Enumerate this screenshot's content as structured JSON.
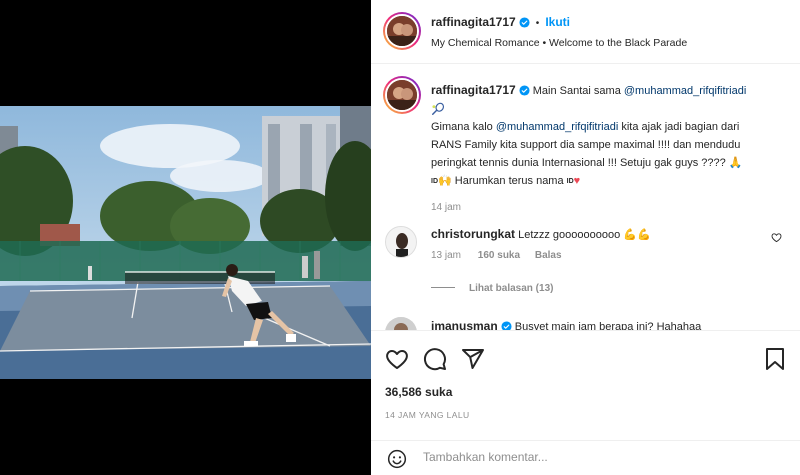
{
  "header": {
    "username": "raffinagita1717",
    "separator": "•",
    "follow_label": "Ikuti",
    "subtitle": "My Chemical Romance • Welcome to the Black Parade"
  },
  "caption": {
    "username": "raffinagita1717",
    "title_text": "Main Santai sama",
    "title_mention": "@muhammad_rifqifitriadi",
    "line1_pre": "Gimana kalo",
    "line1_mention": "@muhammad_rifqifitriadi",
    "line1_post": "kita ajak jadi bagian dari",
    "line2": "RANS Family kita support dia sampe maximal !!!! dan mendudu",
    "line3": "peringkat tennis dunia Internasional !!! Setuju gak guys ????",
    "line4": "Harumkan terus nama",
    "time": "14 jam"
  },
  "comments": [
    {
      "username": "christorungkat",
      "text": "Letzzz goooooooooo",
      "time": "13 jam",
      "likes": "160 suka",
      "reply": "Balas",
      "view_replies": "Lihat balasan (13)"
    },
    {
      "username": "imanusman",
      "text": "Busyet main jam berapa ini? Hahahaa"
    }
  ],
  "actions": {
    "likes": "36,586 suka",
    "timestamp": "14 JAM YANG LALU"
  },
  "add_comment": {
    "placeholder": "Tambahkan komentar..."
  },
  "icons": {
    "verified": "verified-badge-icon",
    "like": "heart-icon",
    "comment": "comment-icon",
    "share": "share-icon",
    "save": "bookmark-icon",
    "emoji": "emoji-icon",
    "mute": "muted-speaker-icon"
  },
  "colors": {
    "link_blue": "#0095f6",
    "mention": "#00376b",
    "verified": "#0095f6",
    "muted_text": "#8e8e8e"
  }
}
